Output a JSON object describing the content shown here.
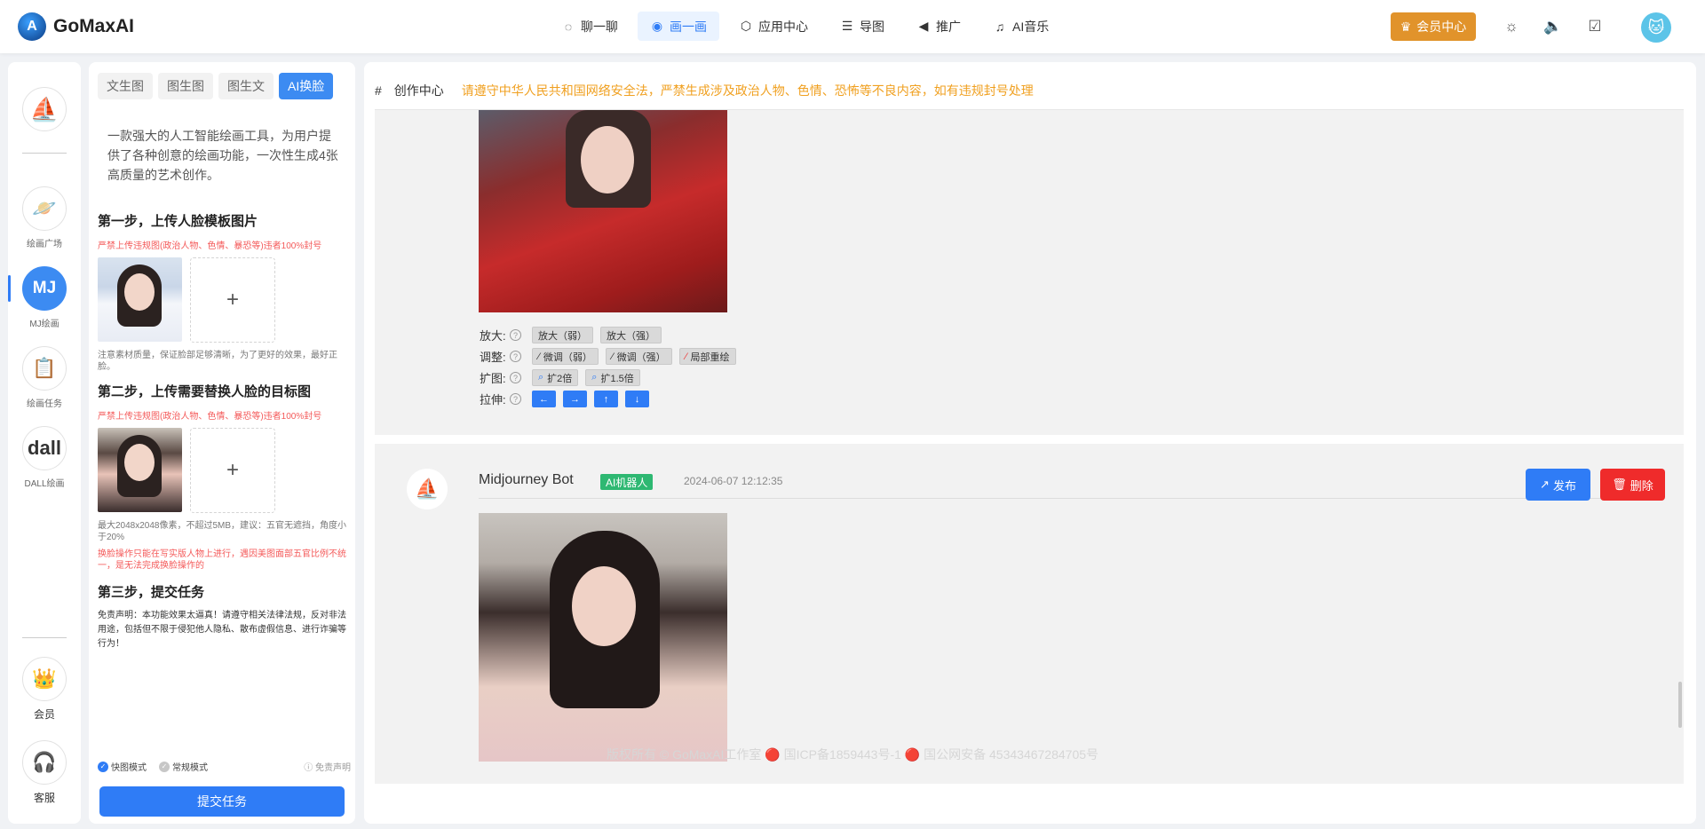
{
  "app": {
    "logo_text": "GoMaxAI"
  },
  "nav": [
    {
      "label": "聊一聊",
      "icon": "chat-bubble-icon"
    },
    {
      "label": "画一画",
      "icon": "palette-icon",
      "active": true
    },
    {
      "label": "应用中心",
      "icon": "cube-icon"
    },
    {
      "label": "导图",
      "icon": "mindmap-icon"
    },
    {
      "label": "推广",
      "icon": "megaphone-icon"
    },
    {
      "label": "AI音乐",
      "icon": "music-note-icon"
    }
  ],
  "header": {
    "vip_label": "会员中心"
  },
  "rail": {
    "items": [
      {
        "label": "绘画广场",
        "glyph": "🪐"
      },
      {
        "label": "MJ绘画",
        "glyph": "MJ"
      },
      {
        "label": "绘画任务",
        "glyph": "📋"
      },
      {
        "label": "DALL绘画",
        "glyph": "dall"
      },
      {
        "label": "会员",
        "glyph": "👑"
      },
      {
        "label": "客服",
        "glyph": "🎧"
      }
    ]
  },
  "panel": {
    "tabs": [
      "文生图",
      "图生图",
      "图生文",
      "AI换脸"
    ],
    "desc": "一款强大的人工智能绘画工具，为用户提供了各种创意的绘画功能，一次性生成4张高质量的艺术创作。",
    "step1_title": "第一步，上传人脸模板图片",
    "step1_warn": "严禁上传违规图(政治人物、色情、暴恐等)违者100%封号",
    "step1_note": "注意素材质量，保证脸部足够清晰，为了更好的效果，最好正脸。",
    "step2_title": "第二步，上传需要替换人脸的目标图",
    "step2_warn": "严禁上传违规图(政治人物、色情、暴恐等)违者100%封号",
    "step2_note": "最大2048x2048像素，不超过5MB，建议：五官无遮挡，角度小于20%",
    "step2_note_red": "换脸操作只能在写实版人物上进行，遇因美图面部五官比例不统一，是无法完成换脸操作的",
    "step3_title": "第三步，提交任务",
    "disclaimer": "免责声明：本功能效果太逼真！请遵守相关法律法规，反对非法用途，包括但不限于侵犯他人隐私、散布虚假信息、进行诈骗等行为！",
    "mode_fast": "快图模式",
    "mode_normal": "常规模式",
    "disclaimer_link": "免责声明",
    "submit": "提交任务",
    "plus": "+"
  },
  "main": {
    "hash": "#",
    "title": "创作中心",
    "notice": "请遵守中华人民共和国网络安全法，严禁生成涉及政治人物、色情、恐怖等不良内容，如有违规封号处理",
    "controls": {
      "zoom_label": "放大:",
      "zoom": [
        "放大（弱）",
        "放大（强）"
      ],
      "adjust_label": "调整:",
      "adjust": [
        "微调（弱）",
        "微调（强）",
        "局部重绘"
      ],
      "expand_label": "扩图:",
      "expand": [
        "扩2倍",
        "扩1.5倍"
      ],
      "stretch_label": "拉伸:",
      "stretch": [
        "←",
        "→",
        "↑",
        "↓"
      ]
    },
    "message": {
      "bot_name": "Midjourney Bot",
      "bot_tag": "AI机器人",
      "time": "2024-06-07 12:12:35",
      "publish": "发布",
      "delete": "删除"
    }
  },
  "footer": "版权所有 © GoMaxAI工作室 🔴 国ICP备1859443号-1 🔴 国公网安备 45343467284705号"
}
